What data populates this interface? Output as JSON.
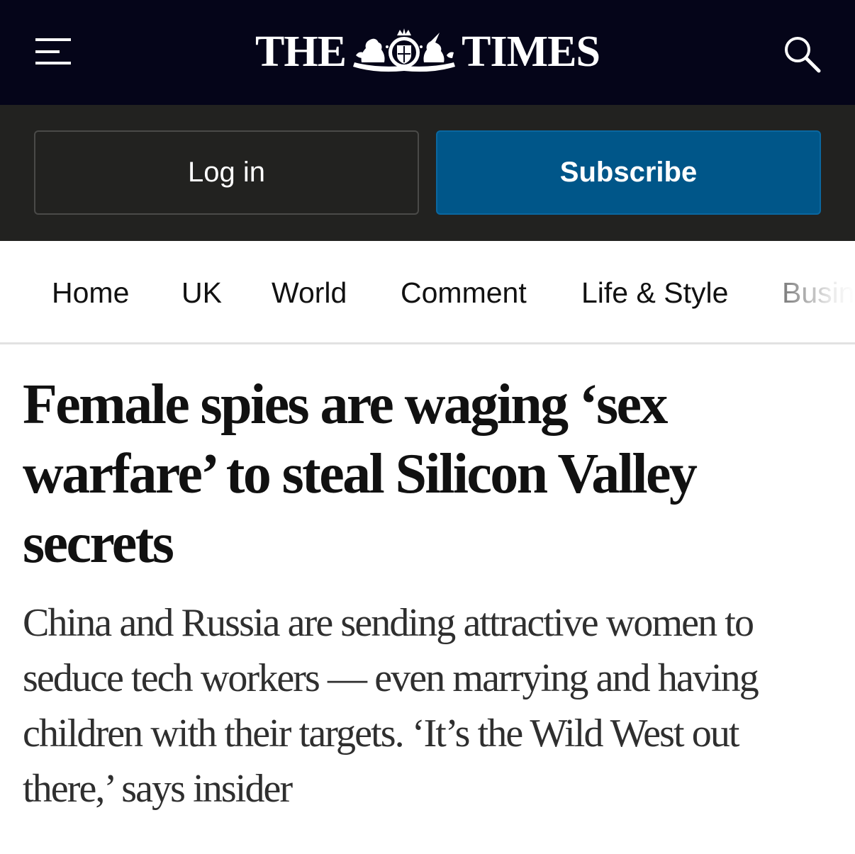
{
  "masthead": {
    "logo_left": "THE",
    "logo_right": "TIMES",
    "menu_icon": "hamburger-menu-icon",
    "search_icon": "search-icon"
  },
  "account": {
    "login_label": "Log in",
    "subscribe_label": "Subscribe"
  },
  "nav": {
    "items": [
      {
        "label": "Home"
      },
      {
        "label": "UK"
      },
      {
        "label": "World"
      },
      {
        "label": "Comment"
      },
      {
        "label": "Life & Style"
      },
      {
        "label": "Busin"
      }
    ]
  },
  "article": {
    "headline": "Female spies are waging ‘sex warfare’ to steal Silicon Valley secrets",
    "standfirst": "China and Russia are sending attractive women to seduce tech workers — even marrying and having children with their targets. ‘It’s the Wild West out there,’ says insider"
  },
  "colors": {
    "masthead_bg": "#050519",
    "account_bar_bg": "#222220",
    "subscribe_bg": "#005689",
    "text": "#111111"
  }
}
